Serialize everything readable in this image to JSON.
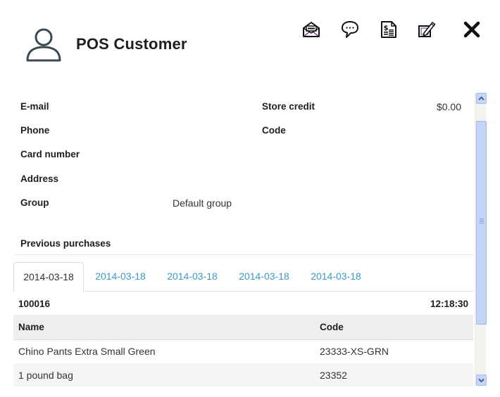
{
  "header": {
    "title": "POS Customer",
    "avatar_icon": "user-icon",
    "actions": [
      {
        "name": "send-email",
        "icon": "envelope-icon"
      },
      {
        "name": "send-message",
        "icon": "speech-bubble-icon"
      },
      {
        "name": "invoice",
        "icon": "invoice-icon"
      },
      {
        "name": "edit",
        "icon": "edit-icon"
      },
      {
        "name": "close",
        "icon": "close-icon"
      }
    ]
  },
  "fields": {
    "email": {
      "label": "E-mail",
      "value": ""
    },
    "phone": {
      "label": "Phone",
      "value": ""
    },
    "card_number": {
      "label": "Card number",
      "value": ""
    },
    "address": {
      "label": "Address",
      "value": ""
    },
    "group": {
      "label": "Group",
      "value": "Default group"
    },
    "store_credit": {
      "label": "Store credit",
      "value": "$0.00"
    },
    "code": {
      "label": "Code",
      "value": ""
    }
  },
  "purchases": {
    "title": "Previous purchases",
    "tabs": [
      {
        "label": "2014-03-18",
        "active": true
      },
      {
        "label": "2014-03-18",
        "active": false
      },
      {
        "label": "2014-03-18",
        "active": false
      },
      {
        "label": "2014-03-18",
        "active": false
      },
      {
        "label": "2014-03-18",
        "active": false
      }
    ],
    "order": {
      "id": "100016",
      "time": "12:18:30",
      "columns": [
        "Name",
        "Code"
      ],
      "rows": [
        {
          "name": "Chino Pants Extra Small Green",
          "code": "23333-XS-GRN"
        },
        {
          "name": "1 pound bag",
          "code": "23352"
        }
      ]
    }
  },
  "colors": {
    "tab_link": "#3a9ac4",
    "scrollbar_thumb": "#c3d4fa",
    "table_header_bg": "#eeeeee"
  }
}
